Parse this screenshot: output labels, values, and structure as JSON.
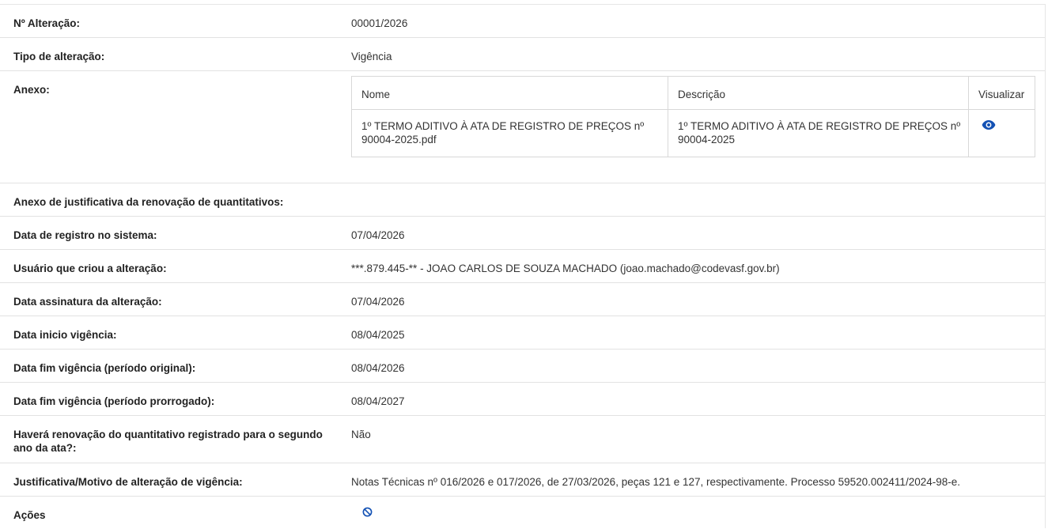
{
  "fields": [
    {
      "label": "Nº Alteração:",
      "value": "00001/2026"
    },
    {
      "label": "Tipo de alteração:",
      "value": "Vigência"
    },
    {
      "label": "Anexo:",
      "value": ""
    },
    {
      "label": "Anexo de justificativa da renovação de quantitativos:",
      "value": ""
    },
    {
      "label": "Data de registro no sistema:",
      "value": "07/04/2026"
    },
    {
      "label": "Usuário que criou a alteração:",
      "value": "***.879.445-** - JOAO CARLOS DE SOUZA MACHADO (joao.machado@codevasf.gov.br)"
    },
    {
      "label": "Data assinatura da alteração:",
      "value": "07/04/2026"
    },
    {
      "label": "Data inicio vigência:",
      "value": "08/04/2025"
    },
    {
      "label": "Data fim vigência (período original):",
      "value": "08/04/2026"
    },
    {
      "label": "Data fim vigência (período prorrogado):",
      "value": "08/04/2027"
    },
    {
      "label": "Haverá renovação do quantitativo registrado para o segundo ano da ata?:",
      "value": "Não"
    },
    {
      "label": "Justificativa/Motivo de alteração de vigência:",
      "value": "Notas Técnicas nº 016/2026 e 017/2026, de 27/03/2026, peças 121 e 127, respectivamente. Processo 59520.002411/2024-98-e."
    },
    {
      "label": "Ações",
      "value": ""
    }
  ],
  "anexo_table": {
    "headers": {
      "nome": "Nome",
      "descricao": "Descrição",
      "visualizar": "Visualizar"
    },
    "rows": [
      {
        "nome_line1": "1º TERMO ADITIVO À ATA DE REGISTRO DE PREÇOS nº",
        "nome_line2": "90004-2025.pdf",
        "descricao_line1": "1º TERMO ADITIVO À ATA DE REGISTRO DE PREÇOS nº",
        "descricao_line2": "90004-2025",
        "action_icon": "eye-icon"
      }
    ]
  },
  "label_line2": {
    "renovacao_line1": "Haverá renovação do quantitativo registrado para o segundo",
    "renovacao_line2": "ano da ata?:"
  },
  "icons": {
    "view": "eye-icon",
    "action": "ban-icon"
  },
  "colors": {
    "icon_blue": "#1351b4",
    "border": "#e2e2e2"
  }
}
